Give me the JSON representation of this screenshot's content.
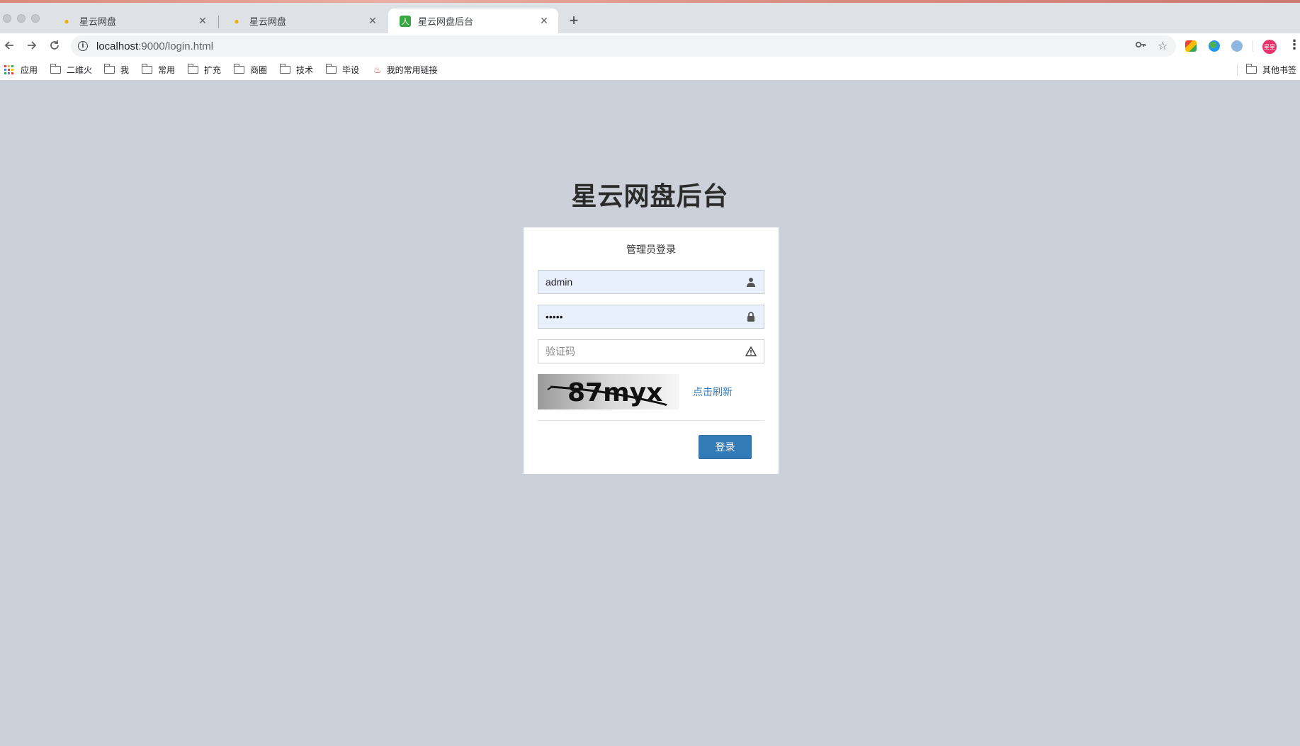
{
  "browser": {
    "tabs": [
      {
        "title": "星云网盘",
        "icon": "pear-icon"
      },
      {
        "title": "星云网盘",
        "icon": "pear-icon"
      },
      {
        "title": "星云网盘后台",
        "icon": "person-icon"
      }
    ],
    "url_host": "localhost",
    "url_path": ":9000/login.html",
    "profile_label": "星星",
    "bookmarks": [
      {
        "label": "应用",
        "icon": "apps-grid-icon"
      },
      {
        "label": "二维火",
        "icon": "folder-icon"
      },
      {
        "label": "我",
        "icon": "folder-icon"
      },
      {
        "label": "常用",
        "icon": "folder-icon"
      },
      {
        "label": "扩充",
        "icon": "folder-icon"
      },
      {
        "label": "商圈",
        "icon": "folder-icon"
      },
      {
        "label": "技术",
        "icon": "folder-icon"
      },
      {
        "label": "毕设",
        "icon": "folder-icon"
      },
      {
        "label": "我的常用链接",
        "icon": "flame-icon"
      }
    ],
    "other_bookmarks": "其他书签"
  },
  "page": {
    "title": "星云网盘后台",
    "subtitle": "管理员登录",
    "username_value": "admin",
    "password_value": "•••••",
    "captcha_placeholder": "验证码",
    "captcha_text": "87myx",
    "refresh_label": "点击刷新",
    "login_label": "登录"
  },
  "colors": {
    "page_background": "#cbd0d9",
    "primary_button": "#337ab7",
    "autofill_background": "#e8f0fe"
  }
}
